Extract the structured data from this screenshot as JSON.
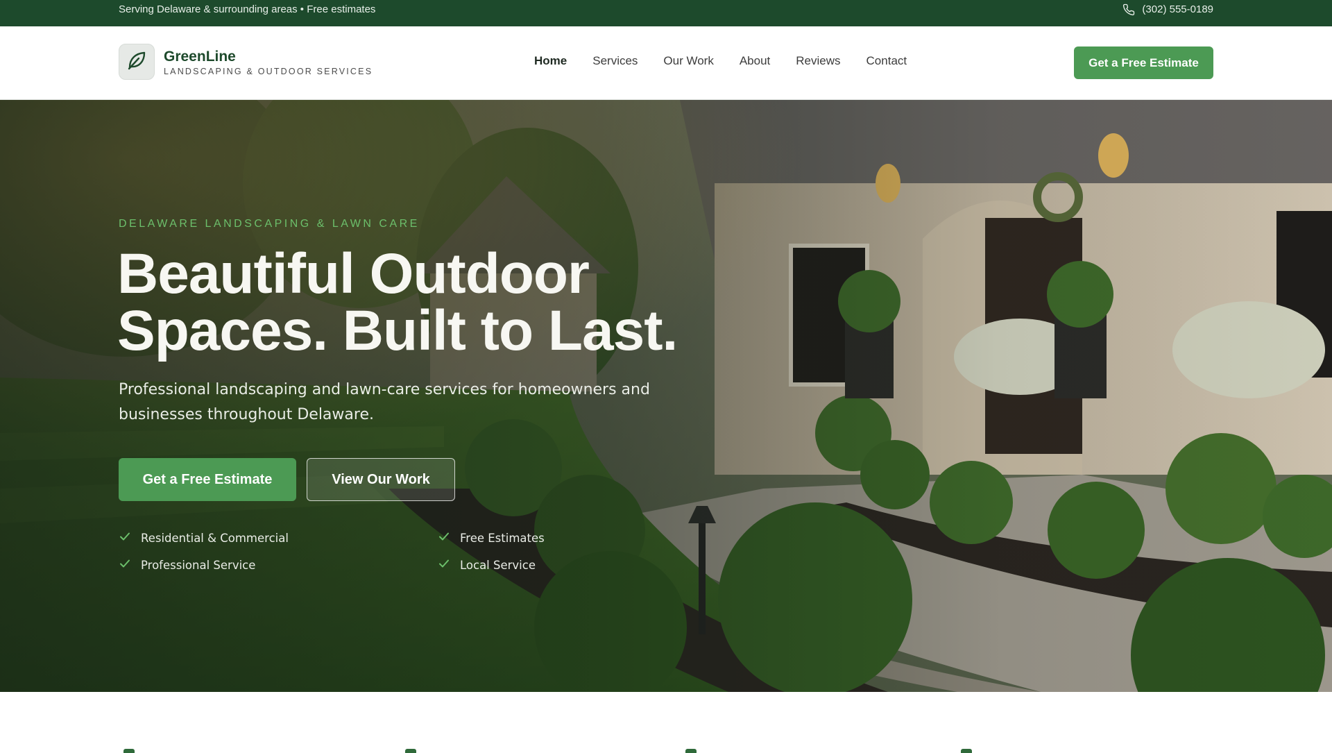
{
  "topbar": {
    "service_area": "Serving Delaware & surrounding areas • Free estimates",
    "phone": "(302) 555-0189",
    "phone_icon": "phone-icon"
  },
  "brand": {
    "name": "GreenLine",
    "tagline": "LANDSCAPING & OUTDOOR SERVICES",
    "logo_icon": "leaf-icon"
  },
  "nav": {
    "items": [
      {
        "label": "Home",
        "active": true
      },
      {
        "label": "Services"
      },
      {
        "label": "Our Work"
      },
      {
        "label": "About"
      },
      {
        "label": "Reviews"
      },
      {
        "label": "Contact"
      }
    ],
    "cta": "Get a Free Estimate"
  },
  "hero": {
    "eyebrow": "DELAWARE LANDSCAPING & LAWN CARE",
    "headline_line1": "Beautiful Outdoor",
    "headline_line2": "Spaces. Built to Last.",
    "subhead": "Professional landscaping and lawn-care services for homeowners and businesses throughout Delaware.",
    "primary_cta": "Get a Free Estimate",
    "secondary_cta": "View Our Work",
    "features": [
      "Residential & Commercial",
      "Free Estimates",
      "Professional Service",
      "Local Service"
    ]
  },
  "colors": {
    "topbar_bg": "#1d4a2c",
    "brand_green": "#4c9a54",
    "eyebrow_green": "#6cbf6b"
  }
}
